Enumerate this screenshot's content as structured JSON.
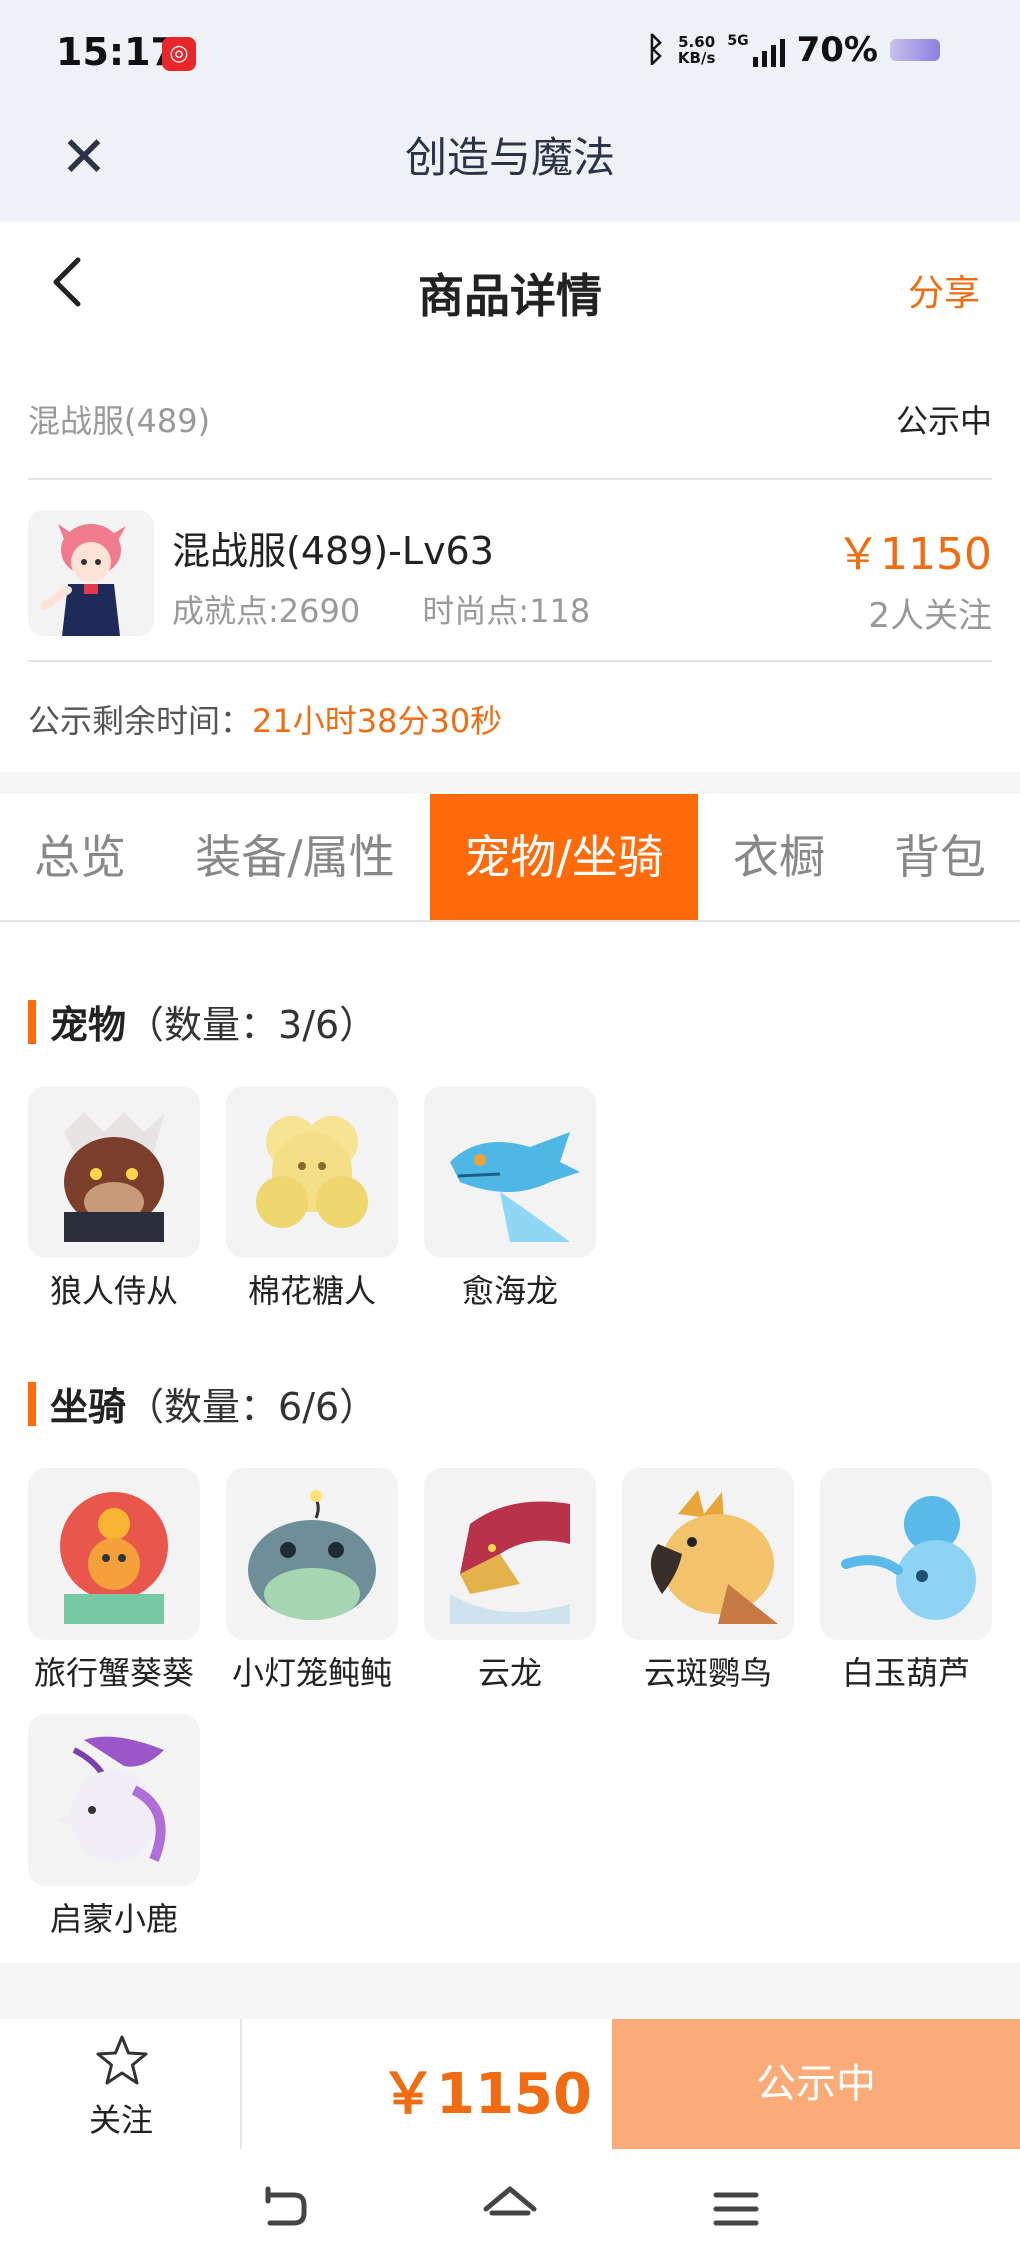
{
  "status_bar": {
    "time": "15:17",
    "net_speed_value": "5.60",
    "net_speed_unit": "KB/s",
    "network": "5G",
    "battery": "70%"
  },
  "app_bar": {
    "title": "创造与魔法"
  },
  "page_header": {
    "title": "商品详情",
    "share_label": "分享"
  },
  "listing": {
    "server": "混战服(489)",
    "status": "公示中",
    "title": "混战服(489)-Lv63",
    "achievement": "成就点:2690",
    "fashion": "时尚点:118",
    "price": "￥1150",
    "followers": "2人关注",
    "countdown_label": "公示剩余时间：",
    "countdown_value": "21小时38分30秒"
  },
  "tabs": [
    {
      "label": "总览",
      "active": false
    },
    {
      "label": "装备/属性",
      "active": false
    },
    {
      "label": "宠物/坐骑",
      "active": true
    },
    {
      "label": "衣橱",
      "active": false
    },
    {
      "label": "背包",
      "active": false
    }
  ],
  "pets": {
    "title": "宠物",
    "count": "（数量：3/6）",
    "items": [
      {
        "name": "狼人侍从",
        "icon": "werewolf-icon",
        "color": "#7a3e2a"
      },
      {
        "name": "棉花糖人",
        "icon": "marshmallow-icon",
        "color": "#f4df86"
      },
      {
        "name": "愈海龙",
        "icon": "sea-dragon-icon",
        "color": "#4fb7e6"
      }
    ]
  },
  "mounts": {
    "title": "坐骑",
    "count": "（数量：6/6）",
    "items": [
      {
        "name": "旅行蟹葵葵",
        "icon": "crab-icon",
        "color": "#e9574c"
      },
      {
        "name": "小灯笼鲀鲀",
        "icon": "lantern-fish-icon",
        "color": "#6f8f98"
      },
      {
        "name": "云龙",
        "icon": "cloud-dragon-icon",
        "color": "#b8334a"
      },
      {
        "name": "云斑鹦鸟",
        "icon": "parrot-icon",
        "color": "#e8a63a"
      },
      {
        "name": "白玉葫芦",
        "icon": "gourd-icon",
        "color": "#59b9e8"
      },
      {
        "name": "启蒙小鹿",
        "icon": "deer-icon",
        "color": "#9b56c8"
      }
    ]
  },
  "bottom_bar": {
    "follow_label": "关注",
    "price": "￥1150",
    "status": "公示中"
  },
  "colors": {
    "accent": "#ff6a0b",
    "price": "#ef6c12",
    "status_button": "#fbab78"
  }
}
